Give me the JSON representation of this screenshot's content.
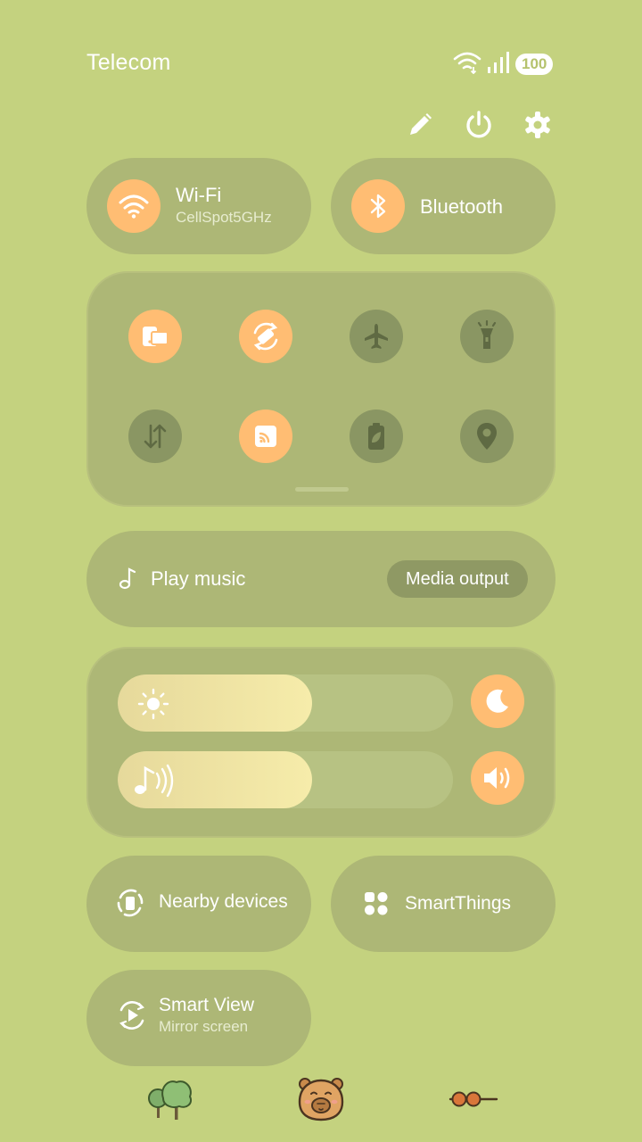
{
  "status_bar": {
    "carrier": "Telecom",
    "battery": "100",
    "icons": [
      "wifi-icon",
      "signal-icon",
      "battery-icon"
    ]
  },
  "header_actions": [
    "edit-icon",
    "power-icon",
    "settings-icon"
  ],
  "tiles": {
    "wifi": {
      "title": "Wi-Fi",
      "subtitle": "CellSpot5GHz",
      "state": "on"
    },
    "bluetooth": {
      "title": "Bluetooth",
      "state": "on"
    }
  },
  "quick_toggles": [
    {
      "icon": "device-switch-icon",
      "state": "on"
    },
    {
      "icon": "auto-rotate-icon",
      "state": "on"
    },
    {
      "icon": "airplane-icon",
      "state": "off"
    },
    {
      "icon": "flashlight-icon",
      "state": "off"
    },
    {
      "icon": "mobile-data-icon",
      "state": "off"
    },
    {
      "icon": "nfc-icon",
      "state": "on"
    },
    {
      "icon": "power-saving-icon",
      "state": "off"
    },
    {
      "icon": "location-icon",
      "state": "off"
    }
  ],
  "media": {
    "label": "Play music",
    "output_button": "Media output"
  },
  "sliders": {
    "brightness": {
      "level": 0.58,
      "icon": "sun-icon",
      "side_icon": "moon-icon"
    },
    "volume": {
      "level": 0.58,
      "icon": "music-volume-icon",
      "side_icon": "speaker-icon"
    }
  },
  "bottom_tiles": {
    "nearby": {
      "title": "Nearby devices"
    },
    "smartthings": {
      "title": "SmartThings"
    },
    "smartview": {
      "title": "Smart View",
      "subtitle": "Mirror screen"
    }
  },
  "decorations": [
    "trees-icon",
    "capybara-icon",
    "skewer-icon"
  ],
  "colors": {
    "background": "#c4d27f",
    "tile": "#adb776",
    "accent_on": "#ffbd73",
    "toggle_off": "#8a9663"
  }
}
